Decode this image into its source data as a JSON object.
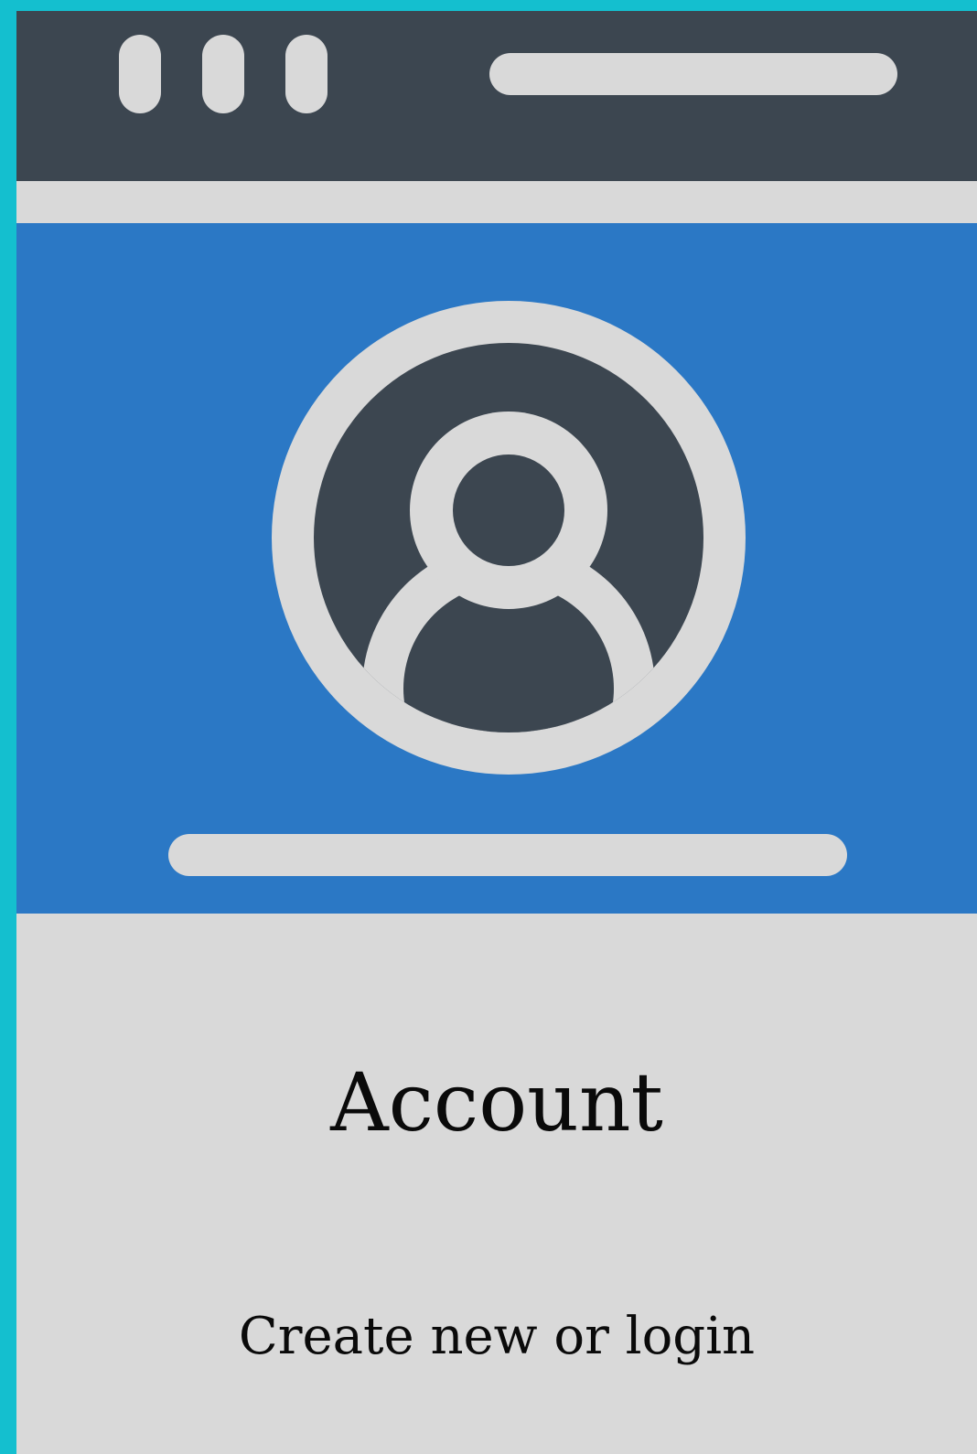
{
  "account": {
    "title": "Account",
    "subtitle": "Create new or login"
  },
  "icons": {
    "window_dots": "window-control-dot-icon",
    "avatar": "user-avatar-icon"
  },
  "colors": {
    "frame_accent": "#14bfcf",
    "titlebar": "#3c4650",
    "banner": "#2b78c5",
    "light": "#d9d9d9",
    "text": "#0a0a0a"
  }
}
